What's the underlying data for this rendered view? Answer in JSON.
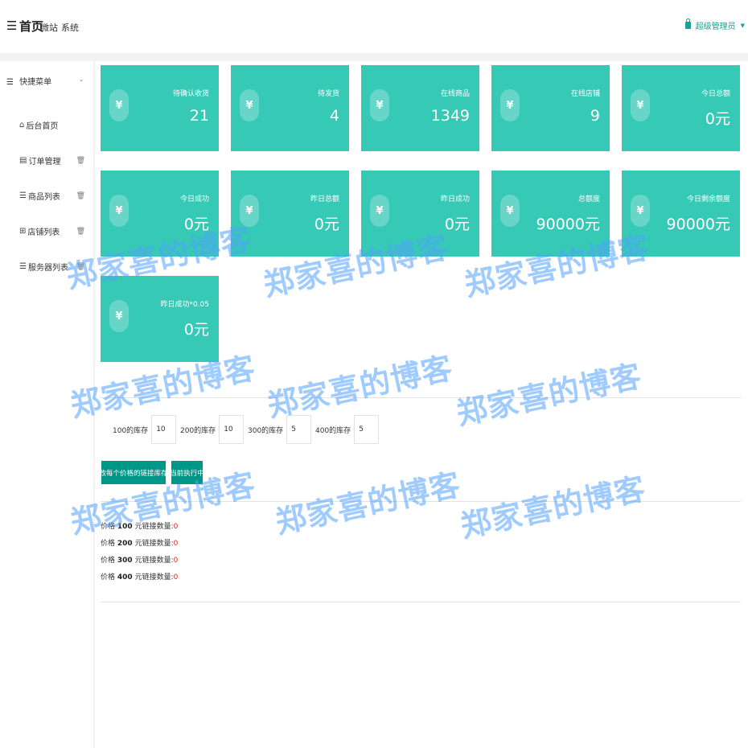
{
  "header": {
    "menu_icon": "hamburger-icon",
    "title": "首页",
    "nav": [
      "微站",
      "系统"
    ],
    "user": "超级管理员"
  },
  "sidebar": {
    "head_label": "快捷菜单",
    "items": [
      {
        "label": "后台首页",
        "icon": "home-icon",
        "has_delete": false
      },
      {
        "label": "订单管理",
        "icon": "order-icon",
        "has_delete": true
      },
      {
        "label": "商品列表",
        "icon": "list-icon",
        "has_delete": true
      },
      {
        "label": "店铺列表",
        "icon": "grid-icon",
        "has_delete": true
      },
      {
        "label": "服务器列表",
        "icon": "list-icon",
        "has_delete": true
      }
    ]
  },
  "stats": [
    {
      "label": "待确认收货",
      "value": "21"
    },
    {
      "label": "待发货",
      "value": "4"
    },
    {
      "label": "在线商品",
      "value": "1349"
    },
    {
      "label": "在线店铺",
      "value": "9"
    },
    {
      "label": "今日总额",
      "value": "0元"
    },
    {
      "label": "今日成功",
      "value": "0元"
    },
    {
      "label": "昨日总额",
      "value": "0元"
    },
    {
      "label": "昨日成功",
      "value": "0元"
    },
    {
      "label": "总额度",
      "value": "90000元"
    },
    {
      "label": "今日剩余额度",
      "value": "90000元"
    },
    {
      "label": "昨日成功*0.05",
      "value": "0元"
    }
  ],
  "stat_symbol": "¥",
  "stock": [
    {
      "label": "100的库存",
      "value": "10"
    },
    {
      "label": "200的库存",
      "value": "10"
    },
    {
      "label": "300的库存",
      "value": "5"
    },
    {
      "label": "400的库存",
      "value": "5"
    }
  ],
  "buttons": {
    "update": "修改每个价格的链接库存量",
    "running": "当前执行中"
  },
  "price_lines": [
    {
      "prefix": "价格",
      "price": "100",
      "suffix": "元链接数量:",
      "count": "0"
    },
    {
      "prefix": "价格",
      "price": "200",
      "suffix": "元链接数量:",
      "count": "0"
    },
    {
      "prefix": "价格",
      "price": "300",
      "suffix": "元链接数量:",
      "count": "0"
    },
    {
      "prefix": "价格",
      "price": "400",
      "suffix": "元链接数量:",
      "count": "0"
    }
  ],
  "watermark": "郑家喜的博客",
  "colors": {
    "card": "#35c9b6",
    "button": "#009688",
    "accent": "#1aa094",
    "count": "#e02020"
  }
}
